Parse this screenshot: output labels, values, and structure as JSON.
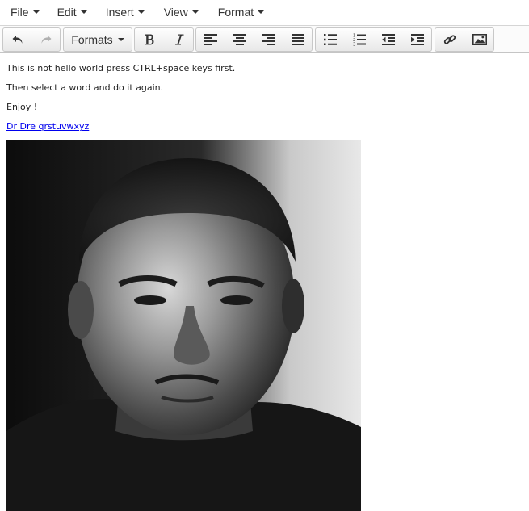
{
  "menubar": {
    "items": [
      {
        "label": "File"
      },
      {
        "label": "Edit"
      },
      {
        "label": "Insert"
      },
      {
        "label": "View"
      },
      {
        "label": "Format"
      }
    ]
  },
  "toolbar": {
    "formats_label": "Formats",
    "icons": {
      "undo": "undo-icon",
      "redo": "redo-icon",
      "bold": "bold-icon",
      "italic": "italic-icon",
      "align_left": "align-left-icon",
      "align_center": "align-center-icon",
      "align_right": "align-right-icon",
      "align_justify": "align-justify-icon",
      "bullet_list": "bullet-list-icon",
      "numbered_list": "numbered-list-icon",
      "outdent": "outdent-icon",
      "indent": "indent-icon",
      "link": "link-icon",
      "image": "image-icon"
    }
  },
  "editor": {
    "paragraphs": [
      "This is not hello world press CTRL+space keys first.",
      "Then select a word and do it again.",
      "Enjoy !"
    ],
    "link_text": "Dr Dre qrstuvwxyz"
  }
}
